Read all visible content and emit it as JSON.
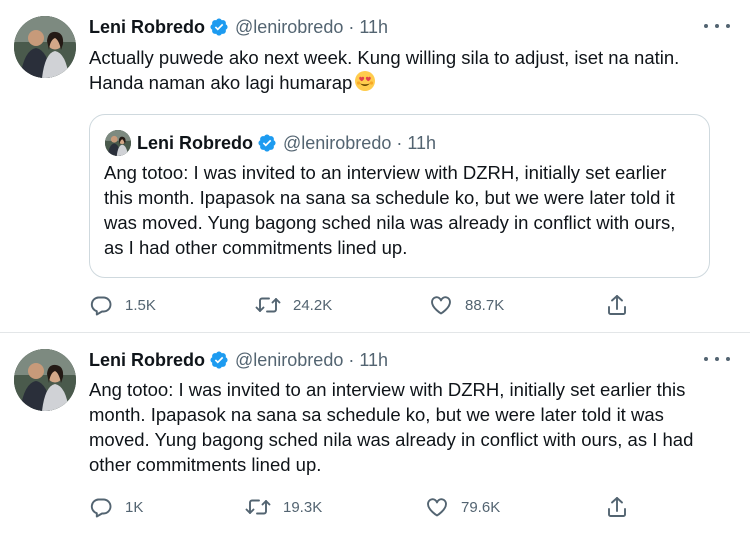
{
  "tweets": [
    {
      "author": "Leni Robredo",
      "handle": "@lenirobredo",
      "separator": "·",
      "time": "11h",
      "text": "Actually puwede ako next week. Kung willing sila to adjust, iset na natin. Handa naman ako lagi humarap",
      "emoji": "smiling-face-with-heart-eyes",
      "quote": {
        "author": "Leni Robredo",
        "handle": "@lenirobredo",
        "separator": "·",
        "time": "11h",
        "text": "Ang totoo: I was invited to an interview with DZRH, initially set earlier this month. Ipapasok na sana sa schedule ko, but we were later told it was moved. Yung bagong sched nila was already in conflict with ours, as I had other commitments lined up."
      },
      "replies": "1.5K",
      "retweets": "24.2K",
      "likes": "88.7K"
    },
    {
      "author": "Leni Robredo",
      "handle": "@lenirobredo",
      "separator": "·",
      "time": "11h",
      "text": "Ang totoo: I was invited to an interview with DZRH, initially set earlier this month. Ipapasok na sana sa schedule ko, but we were later told it was moved. Yung bagong sched nila was already in conflict with ours, as I had other commitments lined up.",
      "replies": "1K",
      "retweets": "19.3K",
      "likes": "79.6K"
    }
  ],
  "colors": {
    "text": "#0f1419",
    "secondary": "#536471",
    "verified": "#1d9bf0",
    "border": "#cfd9de"
  }
}
